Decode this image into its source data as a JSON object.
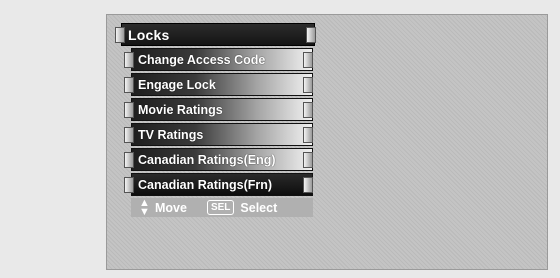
{
  "menu": {
    "title": "Locks",
    "items": [
      {
        "label": "Change Access Code",
        "selected": false
      },
      {
        "label": "Engage Lock",
        "selected": false
      },
      {
        "label": "Movie Ratings",
        "selected": false
      },
      {
        "label": "TV Ratings",
        "selected": false
      },
      {
        "label": "Canadian Ratings(Eng)",
        "selected": false
      },
      {
        "label": "Canadian Ratings(Frn)",
        "selected": true
      }
    ]
  },
  "help": {
    "move_label": "Move",
    "select_key": "SEL",
    "select_label": "Select",
    "move_icon": "up-down-arrows-icon"
  }
}
